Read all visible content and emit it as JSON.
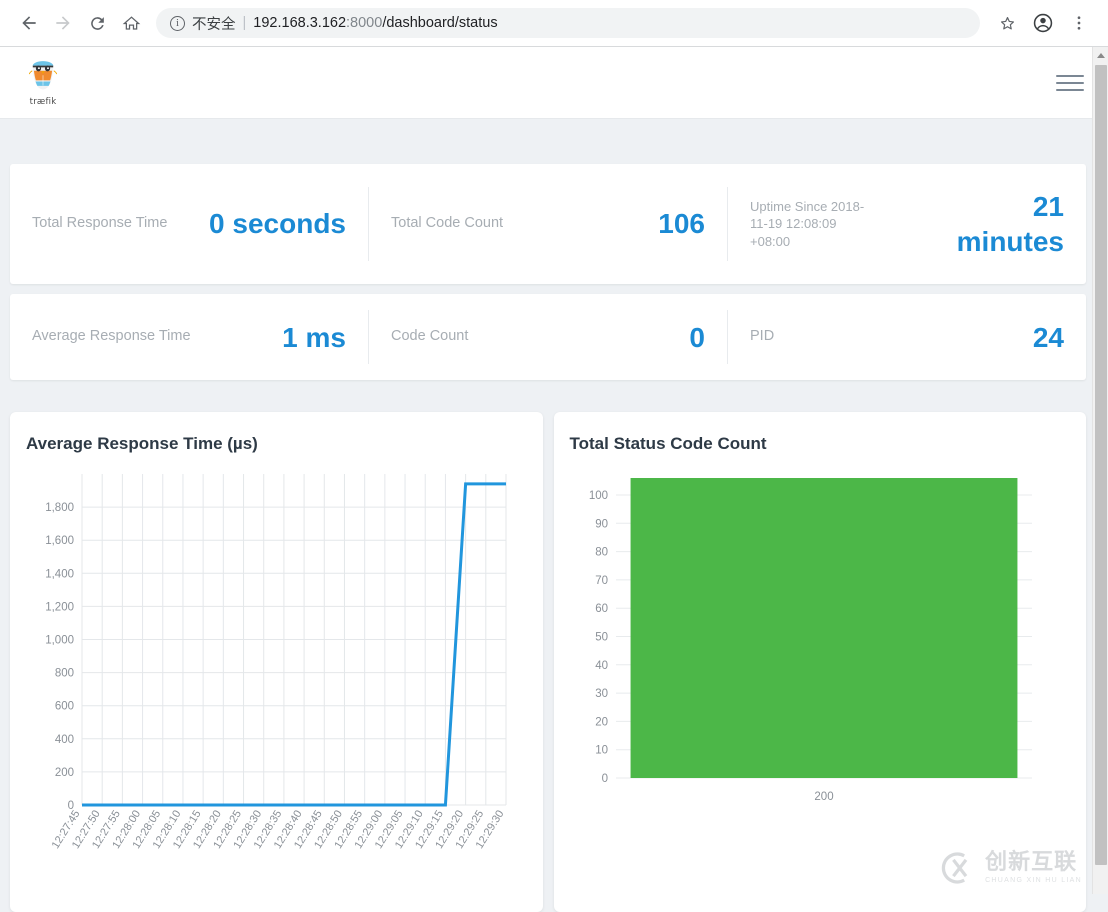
{
  "browser": {
    "back_icon": "arrow-left-icon",
    "forward_icon": "arrow-right-icon",
    "reload_icon": "reload-icon",
    "home_icon": "home-icon",
    "info_icon": "info-icon",
    "security_label": "不安全",
    "separator": "|",
    "url_host": "192.168.3.162",
    "url_rest": ":8000",
    "url_path": "/dashboard/status",
    "star_icon": "bookmark-star-icon",
    "profile_icon": "profile-avatar-icon",
    "menu_icon": "three-dot-menu-icon"
  },
  "header": {
    "logo_icon": "traefik-logo-icon",
    "logo_text": "træfik",
    "menu_icon": "hamburger-menu-icon"
  },
  "stats": {
    "row1": [
      {
        "label": "Total Response Time",
        "value": "0 seconds"
      },
      {
        "label": "Total Code Count",
        "value": "106"
      },
      {
        "label": "Uptime Since 2018-11-19 12:08:09 +08:00",
        "value": "21 minutes"
      }
    ],
    "row2": [
      {
        "label": "Average Response Time",
        "value": "1 ms"
      },
      {
        "label": "Code Count",
        "value": "0"
      },
      {
        "label": "PID",
        "value": "24"
      }
    ]
  },
  "colors": {
    "accent_blue": "#1b8ad4",
    "line_blue": "#2196dd",
    "bar_green": "#4cb748",
    "page_bg": "#eef1f4",
    "label_gray": "#a7adb3"
  },
  "chart_data": [
    {
      "type": "line",
      "title": "Average Response Time (µs)",
      "xlabel": "",
      "ylabel": "",
      "ylim": [
        0,
        2000
      ],
      "yticks": [
        0,
        200,
        400,
        600,
        800,
        1000,
        1200,
        1400,
        1600,
        1800
      ],
      "ytick_labels": [
        "0",
        "200",
        "400",
        "600",
        "800",
        "1,000",
        "1,200",
        "1,400",
        "1,600",
        "1,800"
      ],
      "grid": true,
      "legend": "none",
      "line_color": "#2196dd",
      "x": [
        "12:27:45",
        "12:27:50",
        "12:27:55",
        "12:28:00",
        "12:28:05",
        "12:28:10",
        "12:28:15",
        "12:28:20",
        "12:28:25",
        "12:28:30",
        "12:28:35",
        "12:28:40",
        "12:28:45",
        "12:28:50",
        "12:28:55",
        "12:29:00",
        "12:29:05",
        "12:29:10",
        "12:29:15",
        "12:29:20",
        "12:29:25",
        "12:29:30"
      ],
      "values": [
        0,
        0,
        0,
        0,
        0,
        0,
        0,
        0,
        0,
        0,
        0,
        0,
        0,
        0,
        0,
        0,
        0,
        0,
        0,
        1940,
        1940,
        1940
      ]
    },
    {
      "type": "bar",
      "title": "Total Status Code Count",
      "xlabel": "",
      "ylabel": "",
      "ylim": [
        0,
        106
      ],
      "yticks": [
        0,
        10,
        20,
        30,
        40,
        50,
        60,
        70,
        80,
        90,
        100
      ],
      "ytick_labels": [
        "0",
        "10",
        "20",
        "30",
        "40",
        "50",
        "60",
        "70",
        "80",
        "90",
        "100"
      ],
      "grid": true,
      "legend": "none",
      "bar_color": "#4cb748",
      "categories": [
        "200"
      ],
      "values": [
        106
      ]
    }
  ],
  "watermark": {
    "logo_icon": "circle-x-logo-icon",
    "cn_text": "创新互联",
    "en_text": "CHUANG XIN HU LIAN"
  },
  "scrollbar": {
    "up_arrow_icon": "scroll-up-arrow-icon"
  }
}
